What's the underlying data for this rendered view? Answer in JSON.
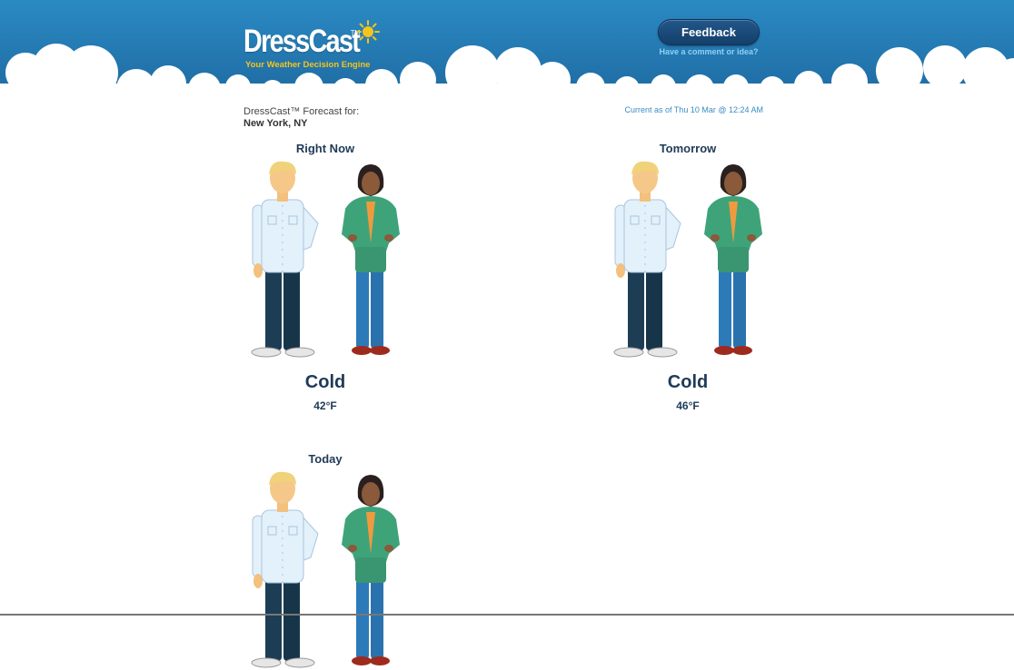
{
  "header": {
    "logo_text": "DressCast",
    "logo_tm": "TM",
    "tagline": "Your Weather Decision Engine",
    "feedback_label": "Feedback",
    "feedback_sub": "Have a comment or idea?"
  },
  "location": {
    "forecast_label": "DressCast™ Forecast for:",
    "city": "New York, NY",
    "updated": "Current as of Thu 10 Mar @ 12:24 AM"
  },
  "panels": [
    {
      "title": "Right Now",
      "condition": "Cold",
      "temp": "42°F"
    },
    {
      "title": "Tomorrow",
      "condition": "Cold",
      "temp": "46°F"
    },
    {
      "title": "Today"
    }
  ],
  "colors": {
    "header_blue": "#2b8ac3",
    "heading_navy": "#1f3a58",
    "link_blue": "#3a8cc4",
    "tagline_yellow": "#f5c51b"
  },
  "icons": [
    "sun-icon"
  ]
}
